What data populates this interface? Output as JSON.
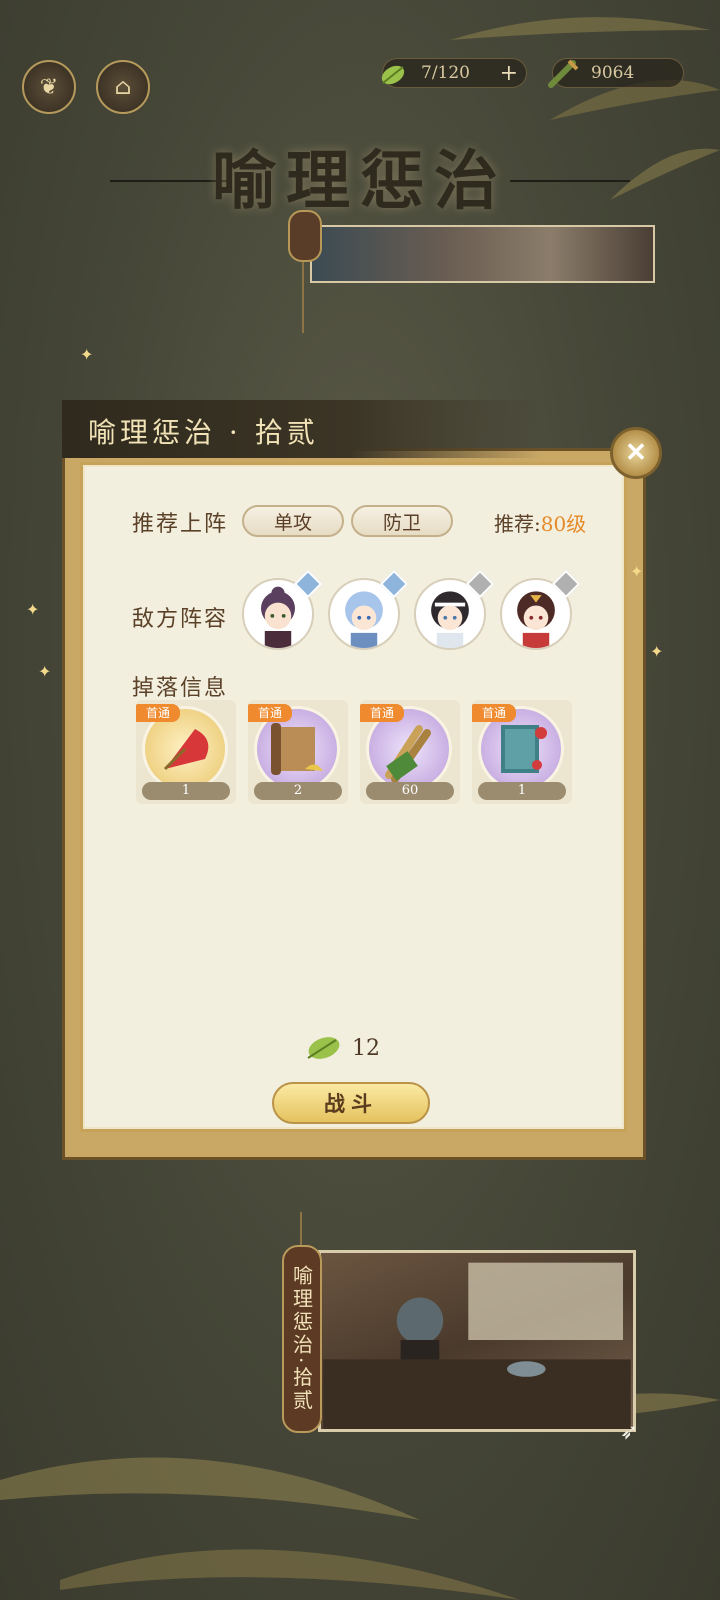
{
  "header": {
    "stamina": "7/120",
    "stamina_add": "+",
    "currency": "9064"
  },
  "page_title": "喻理惩治",
  "dialog": {
    "title": "喻理惩治 · 拾贰",
    "recommend_label": "推荐上阵",
    "roles": [
      "单攻",
      "防卫"
    ],
    "level_label": "推荐:",
    "level_value": "80级",
    "enemy_label": "敌方阵容",
    "drop_label": "掉落信息",
    "drops": [
      {
        "tag": "首通",
        "count": "1",
        "icon": "red-fan-icon"
      },
      {
        "tag": "首通",
        "count": "2",
        "icon": "scroll-icon"
      },
      {
        "tag": "首通",
        "count": "60",
        "icon": "bamboo-slips-icon"
      },
      {
        "tag": "首通",
        "count": "1",
        "icon": "book-icon"
      }
    ],
    "cost": "12",
    "fight_label": "战斗"
  },
  "bottom_tag": "喻理惩治·拾贰",
  "colors": {
    "accent_orange": "#e58a28",
    "gold": "#c7a35a"
  }
}
